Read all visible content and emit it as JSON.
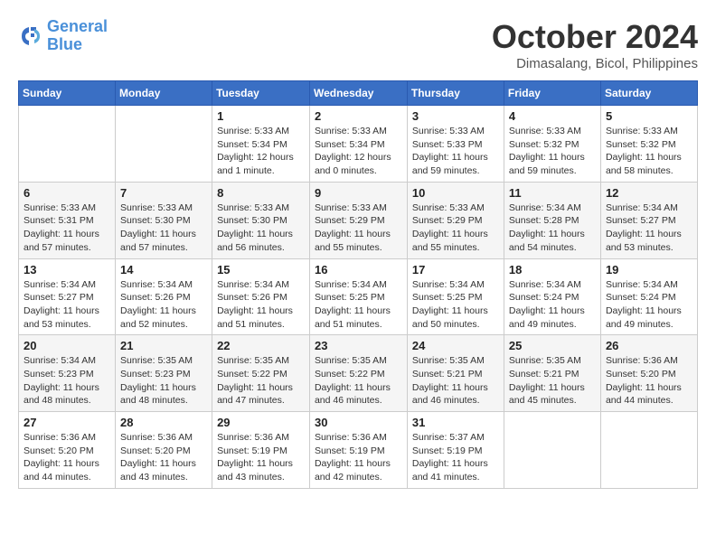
{
  "header": {
    "logo_line1": "General",
    "logo_line2": "Blue",
    "month_year": "October 2024",
    "location": "Dimasalang, Bicol, Philippines"
  },
  "weekdays": [
    "Sunday",
    "Monday",
    "Tuesday",
    "Wednesday",
    "Thursday",
    "Friday",
    "Saturday"
  ],
  "weeks": [
    [
      {
        "day": "",
        "info": ""
      },
      {
        "day": "",
        "info": ""
      },
      {
        "day": "1",
        "info": "Sunrise: 5:33 AM\nSunset: 5:34 PM\nDaylight: 12 hours\nand 1 minute."
      },
      {
        "day": "2",
        "info": "Sunrise: 5:33 AM\nSunset: 5:34 PM\nDaylight: 12 hours\nand 0 minutes."
      },
      {
        "day": "3",
        "info": "Sunrise: 5:33 AM\nSunset: 5:33 PM\nDaylight: 11 hours\nand 59 minutes."
      },
      {
        "day": "4",
        "info": "Sunrise: 5:33 AM\nSunset: 5:32 PM\nDaylight: 11 hours\nand 59 minutes."
      },
      {
        "day": "5",
        "info": "Sunrise: 5:33 AM\nSunset: 5:32 PM\nDaylight: 11 hours\nand 58 minutes."
      }
    ],
    [
      {
        "day": "6",
        "info": "Sunrise: 5:33 AM\nSunset: 5:31 PM\nDaylight: 11 hours\nand 57 minutes."
      },
      {
        "day": "7",
        "info": "Sunrise: 5:33 AM\nSunset: 5:30 PM\nDaylight: 11 hours\nand 57 minutes."
      },
      {
        "day": "8",
        "info": "Sunrise: 5:33 AM\nSunset: 5:30 PM\nDaylight: 11 hours\nand 56 minutes."
      },
      {
        "day": "9",
        "info": "Sunrise: 5:33 AM\nSunset: 5:29 PM\nDaylight: 11 hours\nand 55 minutes."
      },
      {
        "day": "10",
        "info": "Sunrise: 5:33 AM\nSunset: 5:29 PM\nDaylight: 11 hours\nand 55 minutes."
      },
      {
        "day": "11",
        "info": "Sunrise: 5:34 AM\nSunset: 5:28 PM\nDaylight: 11 hours\nand 54 minutes."
      },
      {
        "day": "12",
        "info": "Sunrise: 5:34 AM\nSunset: 5:27 PM\nDaylight: 11 hours\nand 53 minutes."
      }
    ],
    [
      {
        "day": "13",
        "info": "Sunrise: 5:34 AM\nSunset: 5:27 PM\nDaylight: 11 hours\nand 53 minutes."
      },
      {
        "day": "14",
        "info": "Sunrise: 5:34 AM\nSunset: 5:26 PM\nDaylight: 11 hours\nand 52 minutes."
      },
      {
        "day": "15",
        "info": "Sunrise: 5:34 AM\nSunset: 5:26 PM\nDaylight: 11 hours\nand 51 minutes."
      },
      {
        "day": "16",
        "info": "Sunrise: 5:34 AM\nSunset: 5:25 PM\nDaylight: 11 hours\nand 51 minutes."
      },
      {
        "day": "17",
        "info": "Sunrise: 5:34 AM\nSunset: 5:25 PM\nDaylight: 11 hours\nand 50 minutes."
      },
      {
        "day": "18",
        "info": "Sunrise: 5:34 AM\nSunset: 5:24 PM\nDaylight: 11 hours\nand 49 minutes."
      },
      {
        "day": "19",
        "info": "Sunrise: 5:34 AM\nSunset: 5:24 PM\nDaylight: 11 hours\nand 49 minutes."
      }
    ],
    [
      {
        "day": "20",
        "info": "Sunrise: 5:34 AM\nSunset: 5:23 PM\nDaylight: 11 hours\nand 48 minutes."
      },
      {
        "day": "21",
        "info": "Sunrise: 5:35 AM\nSunset: 5:23 PM\nDaylight: 11 hours\nand 48 minutes."
      },
      {
        "day": "22",
        "info": "Sunrise: 5:35 AM\nSunset: 5:22 PM\nDaylight: 11 hours\nand 47 minutes."
      },
      {
        "day": "23",
        "info": "Sunrise: 5:35 AM\nSunset: 5:22 PM\nDaylight: 11 hours\nand 46 minutes."
      },
      {
        "day": "24",
        "info": "Sunrise: 5:35 AM\nSunset: 5:21 PM\nDaylight: 11 hours\nand 46 minutes."
      },
      {
        "day": "25",
        "info": "Sunrise: 5:35 AM\nSunset: 5:21 PM\nDaylight: 11 hours\nand 45 minutes."
      },
      {
        "day": "26",
        "info": "Sunrise: 5:36 AM\nSunset: 5:20 PM\nDaylight: 11 hours\nand 44 minutes."
      }
    ],
    [
      {
        "day": "27",
        "info": "Sunrise: 5:36 AM\nSunset: 5:20 PM\nDaylight: 11 hours\nand 44 minutes."
      },
      {
        "day": "28",
        "info": "Sunrise: 5:36 AM\nSunset: 5:20 PM\nDaylight: 11 hours\nand 43 minutes."
      },
      {
        "day": "29",
        "info": "Sunrise: 5:36 AM\nSunset: 5:19 PM\nDaylight: 11 hours\nand 43 minutes."
      },
      {
        "day": "30",
        "info": "Sunrise: 5:36 AM\nSunset: 5:19 PM\nDaylight: 11 hours\nand 42 minutes."
      },
      {
        "day": "31",
        "info": "Sunrise: 5:37 AM\nSunset: 5:19 PM\nDaylight: 11 hours\nand 41 minutes."
      },
      {
        "day": "",
        "info": ""
      },
      {
        "day": "",
        "info": ""
      }
    ]
  ]
}
